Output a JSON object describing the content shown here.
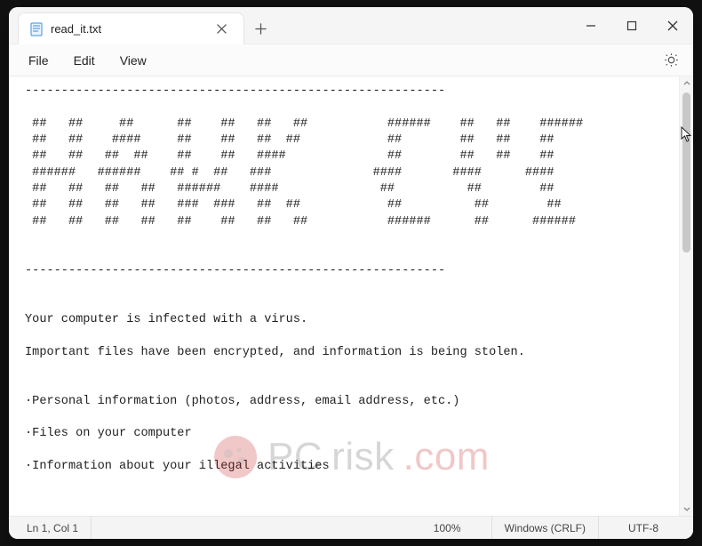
{
  "titlebar": {
    "tab_title": "read_it.txt"
  },
  "menubar": {
    "file": "File",
    "edit": "Edit",
    "view": "View"
  },
  "content": {
    "text": "----------------------------------------------------------\n\n ##   ##     ##      ##    ##   ##   ##           ######    ##   ##    ######\n ##   ##    ####     ##    ##   ##  ##            ##        ##   ##    ##\n ##   ##   ##  ##    ##    ##   ####              ##        ##   ##    ##\n ######   ######    ## #  ##   ###              ####       ####      ####\n ##   ##   ##   ##   ######    ####              ##          ##        ##\n ##   ##   ##   ##   ###  ###   ##  ##            ##          ##        ##\n ##   ##   ##   ##   ##    ##   ##   ##           ######      ##      ######\n\n\n----------------------------------------------------------\n\n\nYour computer is infected with a virus.\n\nImportant files have been encrypted, and information is being stolen.\n\n\n·Personal information (photos, address, email address, etc.)\n\n·Files on your computer\n\n·Information about your illegal activities"
  },
  "statusbar": {
    "position": "Ln 1, Col 1",
    "zoom": "100%",
    "line_ending": "Windows (CRLF)",
    "encoding": "UTF-8"
  },
  "watermark": {
    "brand_a": "PC",
    "brand_b": "risk",
    "brand_c": ".com"
  }
}
